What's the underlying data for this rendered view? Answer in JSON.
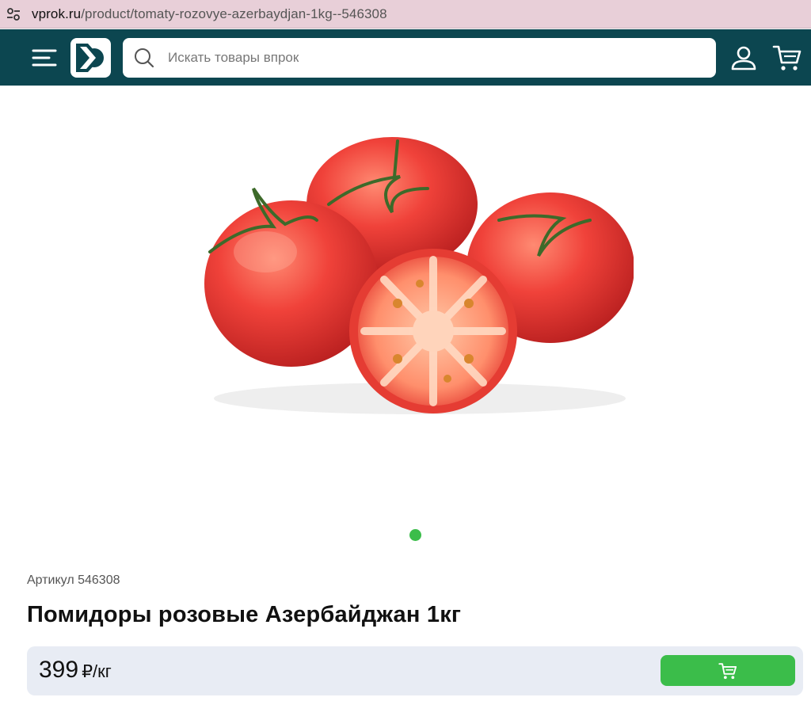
{
  "browser": {
    "url_host": "vprok.ru",
    "url_path": "/product/tomaty-rozovye-azerbaydjan-1kg--546308"
  },
  "header": {
    "search_placeholder": "Искать товары впрок",
    "icons": [
      "menu-icon",
      "logo",
      "search-icon",
      "user-icon",
      "cart-icon"
    ]
  },
  "gallery": {
    "slide_count": 1,
    "active_slide": 1
  },
  "product": {
    "article": "Артикул 546308",
    "title": "Помидоры розовые Азербайджан 1кг",
    "price": "399",
    "price_unit": "₽/кг",
    "add_to_cart_icon": "cart-icon"
  },
  "colors": {
    "header_bg": "#0c4650",
    "accent": "#3bbd4a",
    "price_bar_bg": "#e8ecf4"
  }
}
